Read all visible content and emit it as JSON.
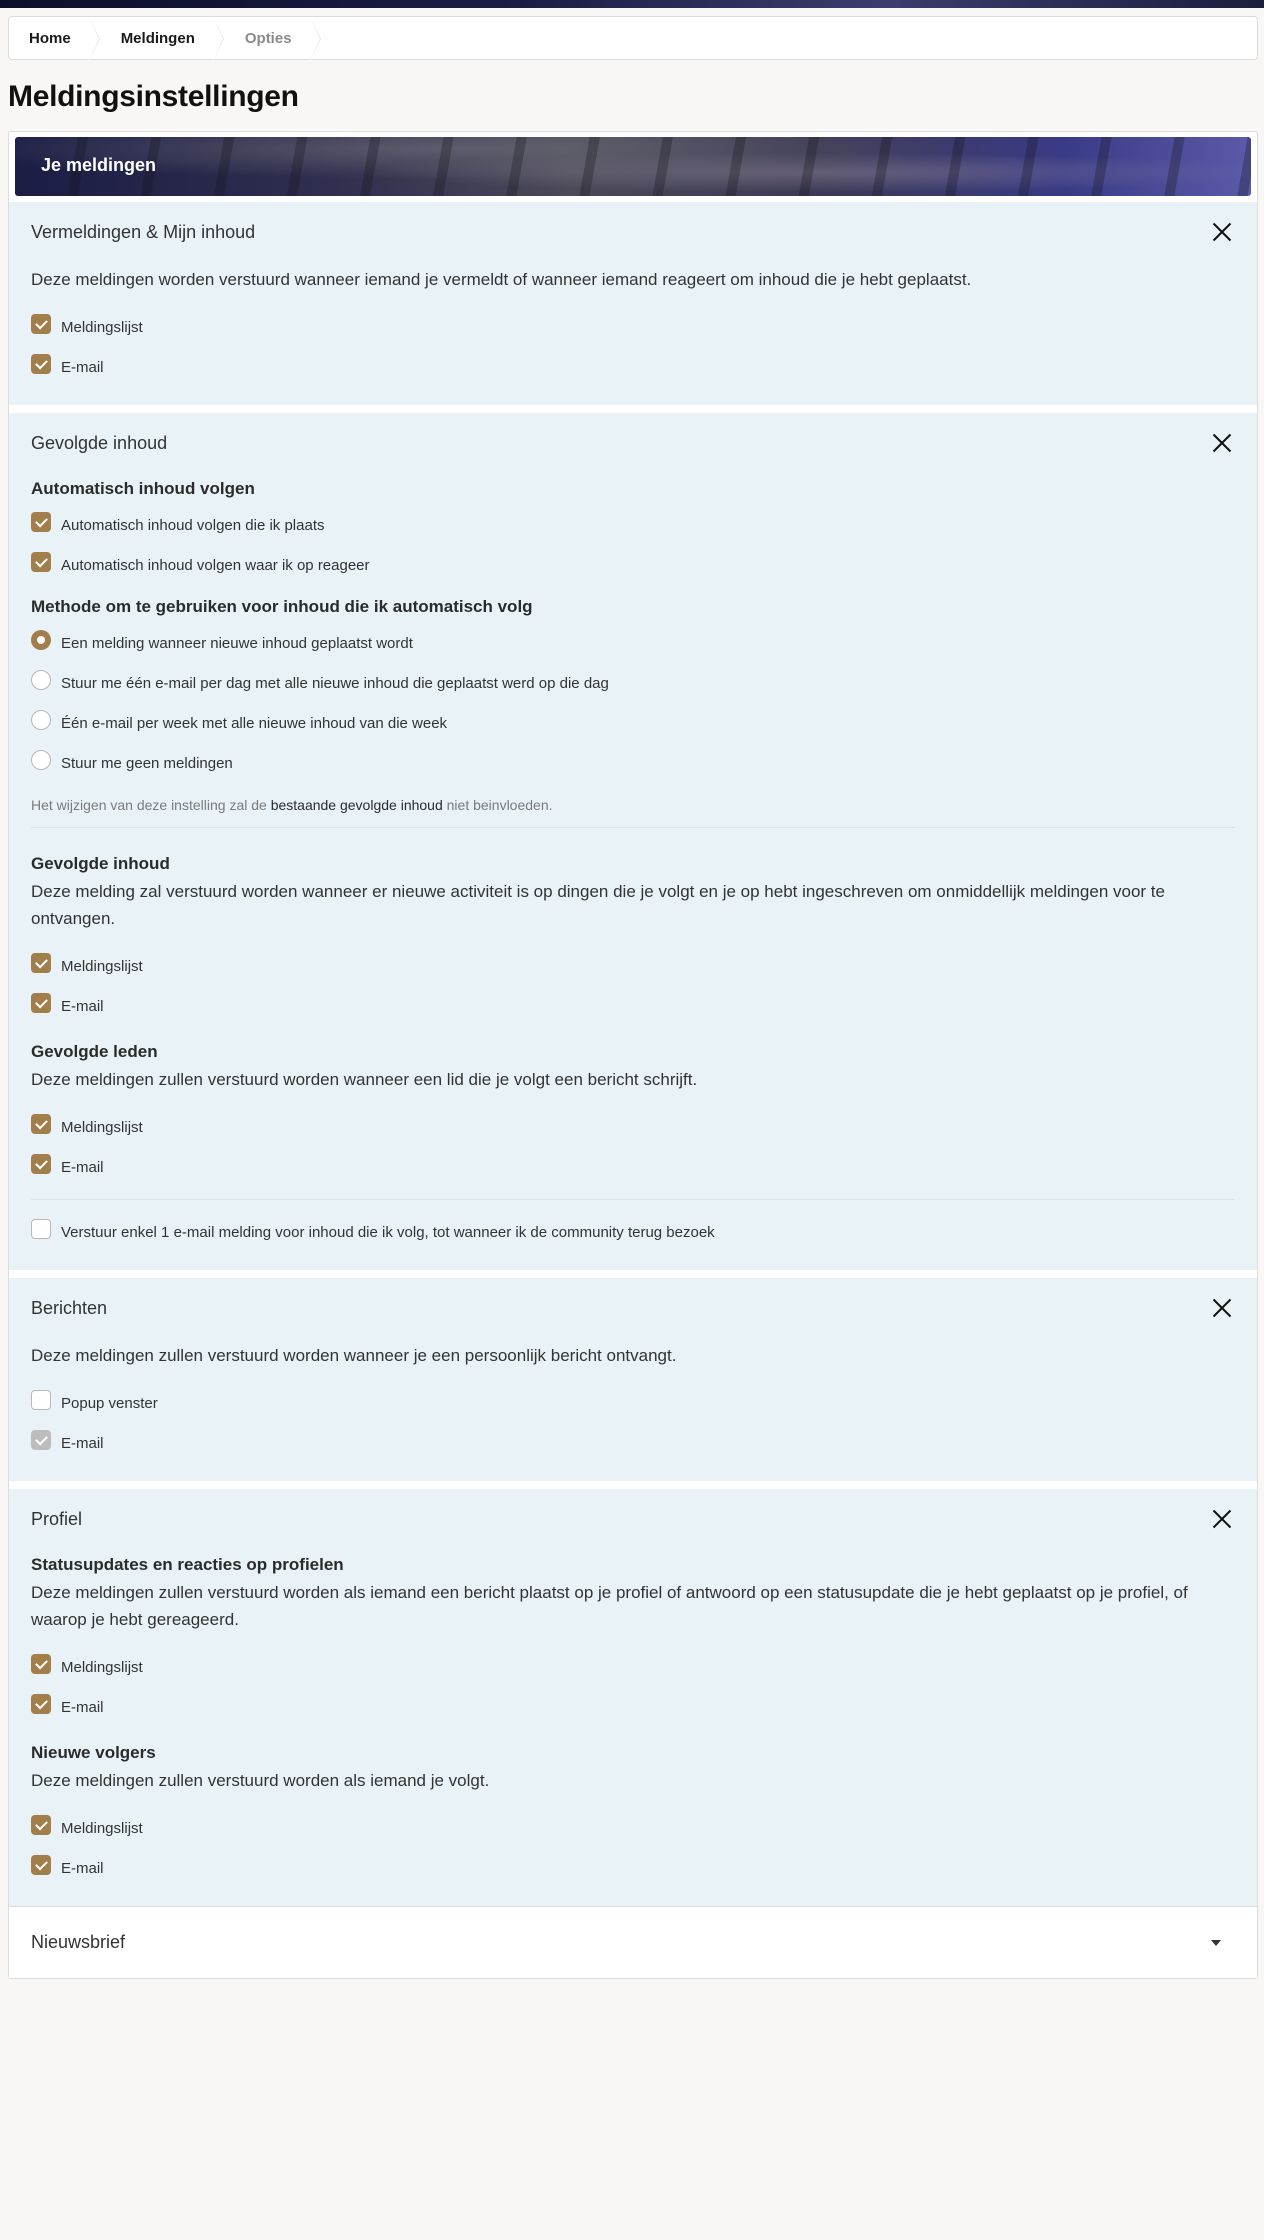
{
  "breadcrumb": [
    "Home",
    "Meldingen",
    "Opties"
  ],
  "page_title": "Meldingsinstellingen",
  "banner_title": "Je meldingen",
  "sections": {
    "mentions": {
      "title": "Vermeldingen & Mijn inhoud",
      "desc": "Deze meldingen worden verstuurd wanneer iemand je vermeldt of wanneer iemand reageert om inhoud die je hebt geplaatst.",
      "options": [
        {
          "label": "Meldingslijst",
          "checked": true
        },
        {
          "label": "E-mail",
          "checked": true
        }
      ]
    },
    "followed": {
      "title": "Gevolgde inhoud",
      "auto_title": "Automatisch inhoud volgen",
      "auto_options": [
        {
          "label": "Automatisch inhoud volgen die ik plaats",
          "checked": true
        },
        {
          "label": "Automatisch inhoud volgen waar ik op reageer",
          "checked": true
        }
      ],
      "method_title": "Methode om te gebruiken voor inhoud die ik automatisch volg",
      "method_options": [
        {
          "label": "Een melding wanneer nieuwe inhoud geplaatst wordt",
          "selected": true
        },
        {
          "label": "Stuur me één e-mail per dag met alle nieuwe inhoud die geplaatst werd op die dag",
          "selected": false
        },
        {
          "label": "Één e-mail per week met alle nieuwe inhoud van die week",
          "selected": false
        },
        {
          "label": "Stuur me geen meldingen",
          "selected": false
        }
      ],
      "note_prefix": "Het wijzigen van deze instelling zal de",
      "note_link": "bestaande gevolgde inhoud",
      "note_suffix": "niet beinvloeden.",
      "content_title": "Gevolgde inhoud",
      "content_desc": "Deze melding zal verstuurd worden wanneer er nieuwe activiteit is op dingen die je volgt en je op hebt ingeschreven om onmiddellijk meldingen voor te ontvangen.",
      "content_options": [
        {
          "label": "Meldingslijst",
          "checked": true
        },
        {
          "label": "E-mail",
          "checked": true
        }
      ],
      "members_title": "Gevolgde leden",
      "members_desc": "Deze meldingen zullen verstuurd worden wanneer een lid die je volgt een bericht schrijft.",
      "members_options": [
        {
          "label": "Meldingslijst",
          "checked": true
        },
        {
          "label": "E-mail",
          "checked": true
        }
      ],
      "single_email": {
        "label": "Verstuur enkel 1 e-mail melding voor inhoud die ik volg, tot wanneer ik de community terug bezoek",
        "checked": false
      }
    },
    "messages": {
      "title": "Berichten",
      "desc": "Deze meldingen zullen verstuurd worden wanneer je een persoonlijk bericht ontvangt.",
      "options": [
        {
          "label": "Popup venster",
          "checked": false
        },
        {
          "label": "E-mail",
          "checked": true,
          "disabled": true
        }
      ]
    },
    "profile": {
      "title": "Profiel",
      "status_title": "Statusupdates en reacties op profielen",
      "status_desc": "Deze meldingen zullen verstuurd worden als iemand een bericht plaatst op je profiel of antwoord op een statusupdate die je hebt geplaatst op je profiel, of waarop je hebt gereageerd.",
      "status_options": [
        {
          "label": "Meldingslijst",
          "checked": true
        },
        {
          "label": "E-mail",
          "checked": true
        }
      ],
      "followers_title": "Nieuwe volgers",
      "followers_desc": "Deze meldingen zullen verstuurd worden als iemand je volgt.",
      "followers_options": [
        {
          "label": "Meldingslijst",
          "checked": true
        },
        {
          "label": "E-mail",
          "checked": true
        }
      ]
    },
    "newsletter": {
      "title": "Nieuwsbrief"
    }
  },
  "colors": {
    "accent": "#a17e4a",
    "section_bg": "#e9f2f7"
  }
}
